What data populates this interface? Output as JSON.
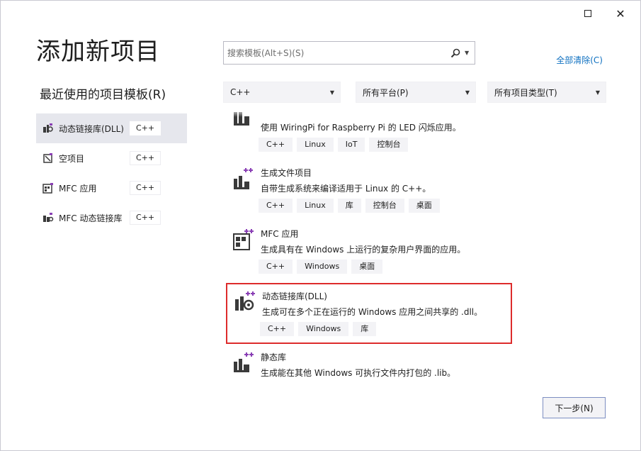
{
  "window": {
    "maximize_label": "",
    "close_label": "✕"
  },
  "title": "添加新项目",
  "recent": {
    "heading": "最近使用的项目模板(R)",
    "items": [
      {
        "label": "动态链接库(DLL)",
        "badge": "C++",
        "icon": "dll-icon",
        "selected": true
      },
      {
        "label": "空项目",
        "badge": "C++",
        "icon": "empty-project-icon"
      },
      {
        "label": "MFC 应用",
        "badge": "C++",
        "icon": "mfc-app-icon"
      },
      {
        "label": "MFC 动态链接库",
        "badge": "C++",
        "icon": "mfc-dll-icon"
      }
    ]
  },
  "search": {
    "placeholder": "搜索模板(Alt+S)(S)",
    "icon": "search-icon"
  },
  "clear_all": "全部清除(C)",
  "filters": {
    "language": "C++",
    "platform": "所有平台(P)",
    "project_type": "所有项目类型(T)"
  },
  "templates": [
    {
      "name": "",
      "desc": "使用 WiringPi for Raspberry Pi 的 LED 闪烁应用。",
      "tags": [
        "C++",
        "Linux",
        "IoT",
        "控制台"
      ],
      "icon": "linux-blink-icon"
    },
    {
      "name": "生成文件项目",
      "desc": "自带生成系统来编译适用于 Linux 的 C++。",
      "tags": [
        "C++",
        "Linux",
        "库",
        "控制台",
        "桌面"
      ],
      "icon": "makefile-project-icon"
    },
    {
      "name": "MFC 应用",
      "desc": "生成具有在 Windows 上运行的复杂用户界面的应用。",
      "tags": [
        "C++",
        "Windows",
        "桌面"
      ],
      "icon": "mfc-app-icon"
    },
    {
      "name": "动态链接库(DLL)",
      "desc": "生成可在多个正在运行的 Windows 应用之间共享的 .dll。",
      "tags": [
        "C++",
        "Windows",
        "库"
      ],
      "icon": "dll-icon",
      "selected": true
    },
    {
      "name": "静态库",
      "desc": "生成能在其他 Windows 可执行文件内打包的 .lib。",
      "tags": [],
      "icon": "static-lib-icon"
    }
  ],
  "next_button": "下一步(N)",
  "colors": {
    "accent_link": "#0e70c0",
    "selection_border": "#dd2c2c",
    "plus_purple": "#8a3fb5"
  }
}
